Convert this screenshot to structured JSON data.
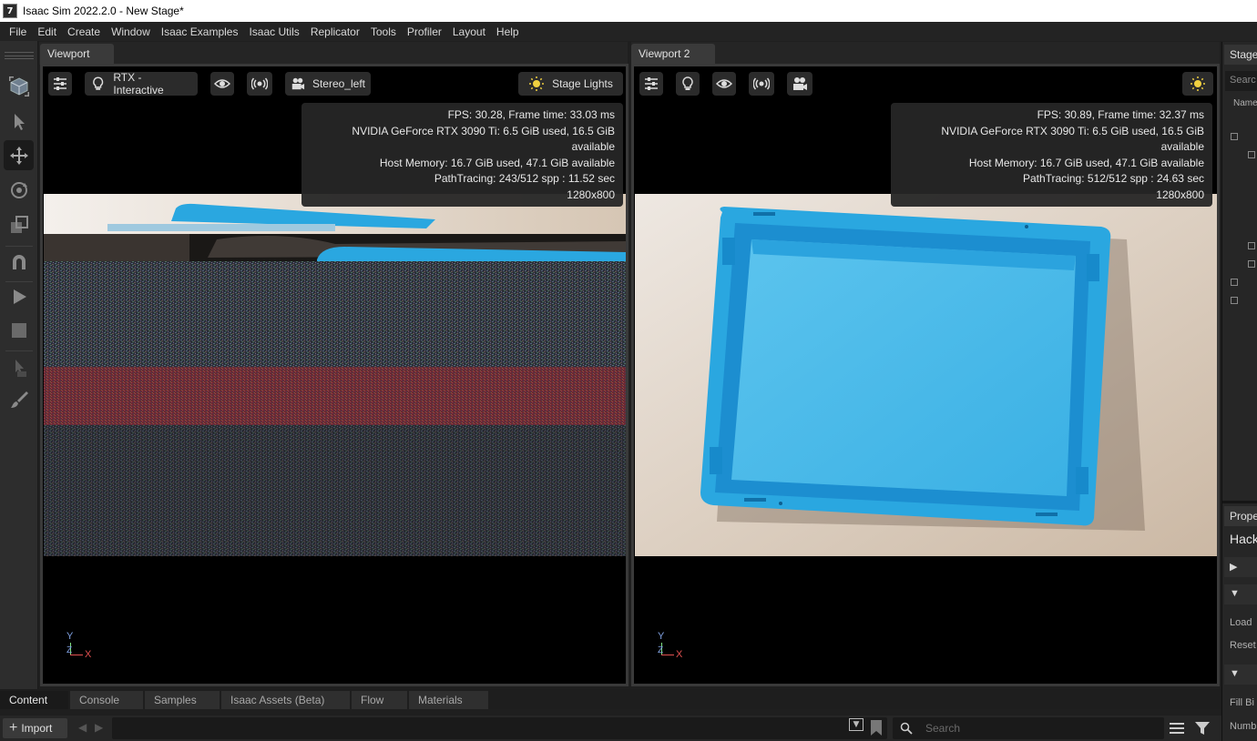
{
  "window": {
    "title": "Isaac Sim 2022.2.0 - New Stage*",
    "app_icon": "7"
  },
  "menu": [
    "File",
    "Edit",
    "Create",
    "Window",
    "Isaac Examples",
    "Isaac Utils",
    "Replicator",
    "Tools",
    "Profiler",
    "Layout",
    "Help"
  ],
  "viewport1": {
    "tab": "Viewport",
    "renderer_label": "RTX - Interactive",
    "camera_label": "Stereo_left",
    "lights_label": "Stage Lights",
    "stats": [
      "FPS: 30.28, Frame time: 33.03 ms",
      "NVIDIA GeForce RTX 3090 Ti: 6.5 GiB used, 16.5 GiB available",
      "Host Memory: 16.7 GiB used, 47.1 GiB available",
      "PathTracing: 243/512 spp : 11.52 sec",
      "1280x800"
    ],
    "axis": {
      "y": "Y",
      "z": "Z",
      "x": "X"
    }
  },
  "viewport2": {
    "tab": "Viewport 2",
    "stats": [
      "FPS: 30.89, Frame time: 32.37 ms",
      "NVIDIA GeForce RTX 3090 Ti: 6.5 GiB used, 16.5 GiB available",
      "Host Memory: 16.7 GiB used, 47.1 GiB available",
      "PathTracing: 512/512 spp : 24.63 sec",
      "1280x800"
    ],
    "axis": {
      "y": "Y",
      "z": "Z",
      "x": "X"
    }
  },
  "stage_panel": {
    "tab": "Stage",
    "search_placeholder": "Searc",
    "column_name": "Name",
    "property_tab": "Prope",
    "property_title": "Hack",
    "rows": [
      "Load",
      "Reset",
      "Fill Bi",
      "Numb"
    ]
  },
  "bottom": {
    "tabs": [
      "Content",
      "Console",
      "Samples",
      "Isaac Assets (Beta)",
      "Flow",
      "Materials"
    ],
    "import_label": "Import",
    "search_placeholder": "Search"
  },
  "colors": {
    "accent_bin": "#2aa7e0",
    "background": "#1f1f1f",
    "viewport": "#000000"
  }
}
